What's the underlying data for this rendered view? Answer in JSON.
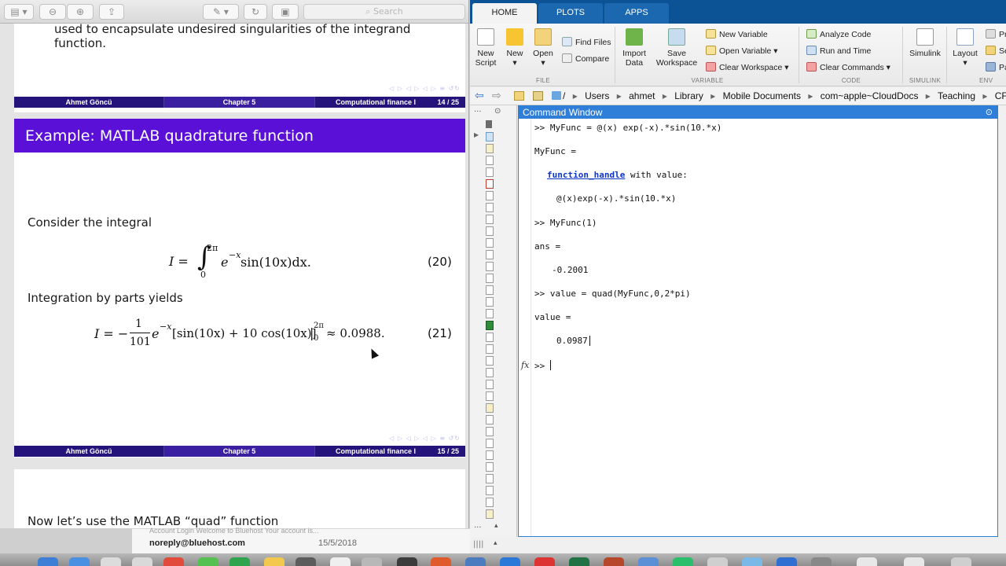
{
  "pdf_viewer": {
    "search_placeholder": "Search",
    "page14": {
      "partial_text": "used to encapsulate undesired singularities of the integrand function.",
      "footer": {
        "author": "Ahmet Göncü",
        "chapter": "Chapter 5",
        "course": "Computational finance I",
        "page": "14 / 25"
      }
    },
    "page15": {
      "title": "Example: MATLAB quadrature function",
      "consider": "Consider the integral",
      "eq20": {
        "lhs": "I =",
        "integral": "∫",
        "upper": "2π",
        "lower": "0",
        "integrand": "e",
        "exp": "−x",
        "rest": " sin(10x)dx.",
        "number": "(20)"
      },
      "integration_by_parts": "Integration by parts yields",
      "eq21": {
        "lhs": "I = −",
        "frac_num": "1",
        "frac_den": "101",
        "e": "e",
        "exp": "−x",
        "bracket": "[sin(10x) + 10 cos(10x)]",
        "bar": "|",
        "upper": "2π",
        "lower": "0",
        "approx": " ≈ 0.0988.",
        "number": "(21)"
      },
      "footer": {
        "author": "Ahmet Göncü",
        "chapter": "Chapter 5",
        "course": "Computational finance I",
        "page": "15 / 25"
      }
    },
    "page16": {
      "partial_text": "Now let’s use the MATLAB “quad” function"
    }
  },
  "matlab": {
    "tabs": [
      "HOME",
      "PLOTS",
      "APPS"
    ],
    "ribbon": {
      "new_script": [
        "New",
        "Script"
      ],
      "new": "New",
      "open": "Open",
      "find_files": "Find Files",
      "compare": "Compare",
      "import_data": [
        "Import",
        "Data"
      ],
      "save_workspace": [
        "Save",
        "Workspace"
      ],
      "new_variable": "New Variable",
      "open_variable": "Open Variable",
      "clear_workspace": "Clear Workspace",
      "analyze_code": "Analyze Code",
      "run_and_time": "Run and Time",
      "clear_commands": "Clear Commands",
      "simulink": "Simulink",
      "layout": "Layout",
      "pr": "Pr",
      "se": "Se",
      "pa": "Pa",
      "sections": {
        "file": "FILE",
        "variable": "VARIABLE",
        "code": "CODE",
        "simulink": "SIMULINK",
        "env": "ENV"
      }
    },
    "address": [
      "/",
      "Users",
      "ahmet",
      "Library",
      "Mobile Documents",
      "com~apple~CloudDocs",
      "Teaching",
      "CF Te"
    ],
    "command_window": {
      "title": "Command Window",
      "l1": ">> MyFunc = @(x) exp(-x).*sin(10.*x)",
      "l2": "MyFunc =",
      "l3_link": "function_handle",
      "l3_rest": " with value:",
      "l4": "@(x)exp(-x).*sin(10.*x)",
      "l5": ">> MyFunc(1)",
      "l6": "ans =",
      "l7": "-0.2001",
      "l8": ">> value = quad(MyFunc,0,2*pi)",
      "l9": "value =",
      "l10": "0.0987",
      "prompt": ">> ",
      "fx": "fx"
    }
  },
  "background_window": {
    "sender": "noreply@bluehost.com",
    "date": "15/5/2018",
    "preview": "Account Login Welcome to Bluehost Your account is..."
  }
}
